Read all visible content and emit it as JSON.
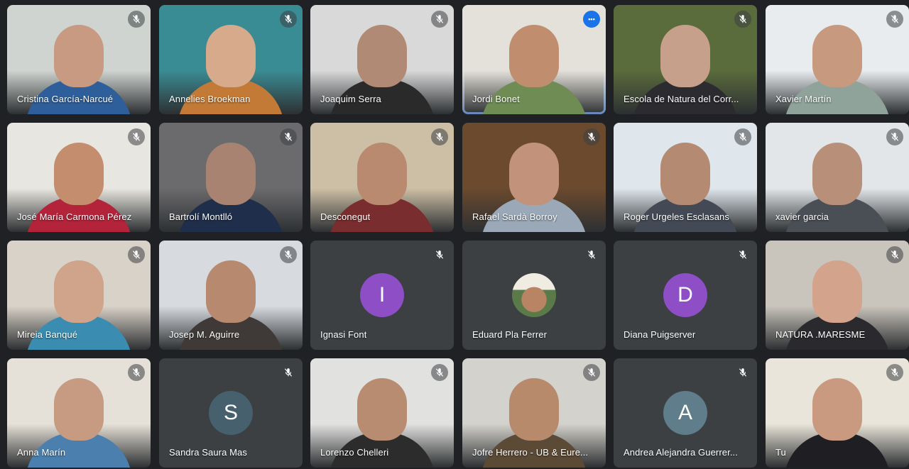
{
  "participants": [
    {
      "name": "Cristina García-Narcué",
      "kind": "video",
      "muted": true,
      "bg": "#cfd4d0",
      "skin": "#c99a82",
      "shirt": "#2f5f9a"
    },
    {
      "name": "Annelies Broekman",
      "kind": "video",
      "muted": true,
      "bg": "#3a8c94",
      "skin": "#d8aa8c",
      "shirt": "#c27a36"
    },
    {
      "name": "Joaquim Serra",
      "kind": "video",
      "muted": true,
      "bg": "#d9d9d9",
      "skin": "#b08a74",
      "shirt": "#2a2a2a"
    },
    {
      "name": "Jordi Bonet",
      "kind": "video",
      "muted": false,
      "active": true,
      "bg": "#e4e1da",
      "skin": "#c08e6f",
      "shirt": "#6f8c55"
    },
    {
      "name": "Escola de Natura del Corr...",
      "kind": "video",
      "muted": true,
      "bg": "#5a6b3c",
      "skin": "#c7a08c",
      "shirt": "#2b2b30"
    },
    {
      "name": "Xavier Martín",
      "kind": "video",
      "muted": true,
      "bg": "#e8ecee",
      "skin": "#c79a80",
      "shirt": "#8fa39a"
    },
    {
      "name": "José María Carmona Pérez",
      "kind": "video",
      "muted": true,
      "bg": "#e8e6e0",
      "skin": "#c48d6d",
      "shirt": "#b3243a"
    },
    {
      "name": "Bartrolí Montlló",
      "kind": "video",
      "muted": true,
      "bg": "#6b6b6e",
      "skin": "#a98372",
      "shirt": "#1f2e4a"
    },
    {
      "name": "Desconegut",
      "kind": "video",
      "muted": true,
      "bg": "#cdbfa6",
      "skin": "#b98a70",
      "shirt": "#7a2d2e"
    },
    {
      "name": "Rafael Sardà Borroy",
      "kind": "video",
      "muted": true,
      "bg": "#6b4a2e",
      "skin": "#c3927a",
      "shirt": "#9aa8b8"
    },
    {
      "name": "Roger Urgeles Esclasans",
      "kind": "video",
      "muted": true,
      "bg": "#dfe6ec",
      "skin": "#b58a72",
      "shirt": "#434a55"
    },
    {
      "name": "xavier garcia",
      "kind": "video",
      "muted": true,
      "bg": "#e3e6e8",
      "skin": "#b8907a",
      "shirt": "#4a4e55"
    },
    {
      "name": "Mireia Banqué",
      "kind": "video",
      "muted": true,
      "bg": "#d9d2c8",
      "skin": "#d0a48a",
      "shirt": "#3a8db0"
    },
    {
      "name": "Josep M. Aguirre",
      "kind": "video",
      "muted": true,
      "bg": "#d7dadf",
      "skin": "#b78a70",
      "shirt": "#3f3a38"
    },
    {
      "name": "Ignasi Font",
      "kind": "initial",
      "muted": true,
      "initial": "I",
      "avatar_color": "#8e4ec6"
    },
    {
      "name": "Eduard Pla Ferrer",
      "kind": "photo",
      "muted": true
    },
    {
      "name": "Diana Puigserver",
      "kind": "initial",
      "muted": true,
      "initial": "D",
      "avatar_color": "#8e4ec6"
    },
    {
      "name": "NATURA .MARESME",
      "kind": "video",
      "muted": true,
      "bg": "#c9c4bc",
      "skin": "#d3a38c",
      "shirt": "#2a2a2e"
    },
    {
      "name": "Anna Marín",
      "kind": "video",
      "muted": true,
      "bg": "#e6e1d8",
      "skin": "#c79a82",
      "shirt": "#4a7fae"
    },
    {
      "name": "Sandra Saura Mas",
      "kind": "initial",
      "muted": true,
      "initial": "S",
      "avatar_color": "#46606e"
    },
    {
      "name": "Lorenzo Chelleri",
      "kind": "video",
      "muted": true,
      "bg": "#e1e1df",
      "skin": "#b88c70",
      "shirt": "#2c2c2c"
    },
    {
      "name": "Jofre Herrero - UB & Eure...",
      "kind": "video",
      "muted": true,
      "bg": "#d4d2cc",
      "skin": "#b88a6c",
      "shirt": "#5b4a36"
    },
    {
      "name": "Andrea Alejandra Guerrer...",
      "kind": "initial",
      "muted": true,
      "initial": "A",
      "avatar_color": "#5f7d8a"
    },
    {
      "name": "Tu",
      "kind": "video",
      "muted": true,
      "bg": "#e9e5da",
      "skin": "#c99a80",
      "shirt": "#1f1f23"
    }
  ],
  "icons": {
    "muted": "mic-off-icon",
    "more": "more-options-icon"
  },
  "colors": {
    "background": "#202124",
    "tile": "#3c4043",
    "active_border": "#8ab4f8",
    "more_button": "#1a73e8"
  }
}
